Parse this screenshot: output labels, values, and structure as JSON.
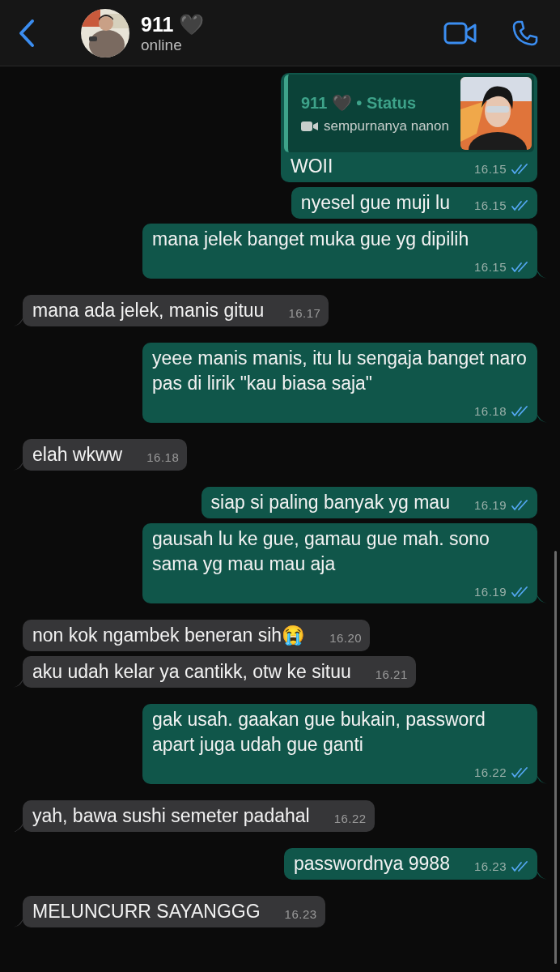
{
  "header": {
    "name": "911 🖤",
    "status": "online"
  },
  "messages": [
    {
      "kind": "out",
      "tail": false,
      "quote": {
        "title": "911 🖤 • Status",
        "text": "sempurnanya nanon"
      },
      "text": "WOII",
      "time": "16.15",
      "read": true
    },
    {
      "kind": "out",
      "tail": false,
      "text": "nyesel gue muji lu",
      "time": "16.15",
      "read": true
    },
    {
      "kind": "out",
      "tail": true,
      "text": "mana jelek banget muka gue yg dipilih",
      "time": "16.15",
      "read": true
    },
    {
      "kind": "in",
      "tail": true,
      "text": "mana ada jelek, manis gituu",
      "time": "16.17"
    },
    {
      "kind": "out",
      "tail": true,
      "text": "yeee manis manis, itu lu sengaja banget naro pas di lirik \"kau biasa saja\"",
      "time": "16.18",
      "read": true
    },
    {
      "kind": "in",
      "tail": true,
      "text": "elah wkww",
      "time": "16.18"
    },
    {
      "kind": "out",
      "tail": false,
      "text": "siap si paling banyak yg mau",
      "time": "16.19",
      "read": true
    },
    {
      "kind": "out",
      "tail": true,
      "text": "gausah lu ke gue, gamau gue mah. sono sama yg mau mau aja",
      "time": "16.19",
      "read": true
    },
    {
      "kind": "in",
      "tail": false,
      "text": "non kok ngambek beneran sih😭",
      "time": "16.20"
    },
    {
      "kind": "in",
      "tail": true,
      "text": "aku udah kelar ya cantikk, otw ke situu",
      "time": "16.21"
    },
    {
      "kind": "out",
      "tail": true,
      "text": "gak usah. gaakan gue bukain, password apart juga udah gue ganti",
      "time": "16.22",
      "read": true
    },
    {
      "kind": "in",
      "tail": true,
      "text": "yah, bawa sushi semeter padahal",
      "time": "16.22"
    },
    {
      "kind": "out",
      "tail": true,
      "text": "passwordnya 9988",
      "time": "16.23",
      "read": true
    },
    {
      "kind": "in",
      "tail": true,
      "text": "MELUNCURR SAYANGGG",
      "time": "16.23"
    }
  ]
}
